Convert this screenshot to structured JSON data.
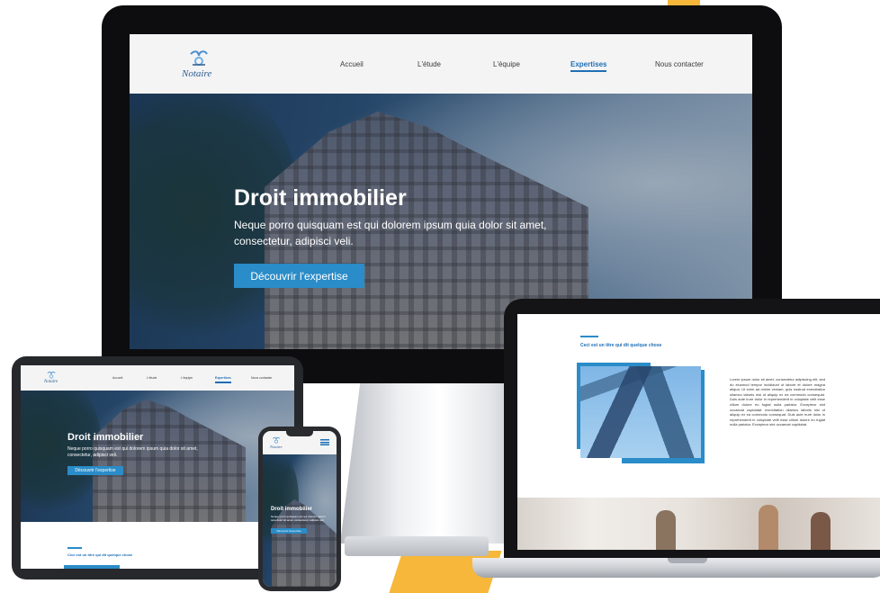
{
  "brand": {
    "name": "Notaire"
  },
  "nav": {
    "items": [
      {
        "label": "Accueil"
      },
      {
        "label": "L'étude"
      },
      {
        "label": "L'équipe"
      },
      {
        "label": "Expertises",
        "active": true
      },
      {
        "label": "Nous contacter"
      }
    ]
  },
  "hero": {
    "title": "Droit immobilier",
    "text": "Neque porro quisquam est qui dolorem ipsum quia dolor sit amet, consectetur, adipisci veli.",
    "cta": "Découvrir l'expertise"
  },
  "section": {
    "title": "Ceci est un titre qui dit quelque chose",
    "body": "Lorem ipsum dolor sit amet, consectetur adipiscing elit, sed do eiusmod tempor incididunt ut labore et dolore magna aliqua. Ut enim ad minim veniam, quis nostrud exercitation ullamco laboris nisi ut aliquip ex ea commodo consequat. Duis aute irure dolor in reprehenderit in voluptate velit esse cillum dolore eu fugiat nulla pariatur. Excepteur sint occaecat cupidatat. exercitation ullamco laboris nisi ut aliquip ex ea commodo consequat. Duis aute irure dolor in reprehenderit in voluptate velit esse cillum dolore eu fugiat nulla pariatur. Excepteur sint occaecat cupidatat."
  },
  "colors": {
    "accent": "#2a8cc8",
    "nav_active": "#1e6fb5",
    "background_shape": "#f6b73a",
    "device_frame": "#0d0d0f"
  }
}
